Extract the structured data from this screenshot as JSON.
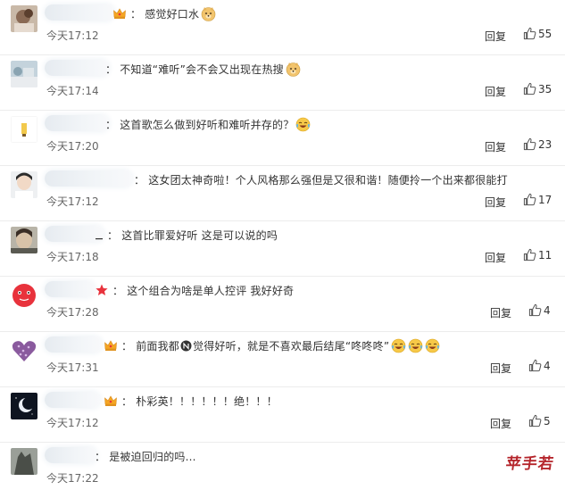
{
  "comments": [
    {
      "text": "感觉好口水",
      "time": "今天17:12",
      "reply": "回复",
      "likes": "55",
      "badge": "crown",
      "emoji": [
        "doge"
      ]
    },
    {
      "text": "不知道“难听”会不会又出现在热搜",
      "time": "今天17:14",
      "reply": "回复",
      "likes": "35",
      "badge": "none",
      "emoji": [
        "doge"
      ]
    },
    {
      "text": "这首歌怎么做到好听和难听并存的？",
      "time": "今天17:20",
      "reply": "回复",
      "likes": "23",
      "badge": "none",
      "emoji": [
        "laugh-cry"
      ]
    },
    {
      "text": "这女团太神奇啦！个人风格那么强但是又很和谐！随便拎一个出来都很能打",
      "time": "今天17:12",
      "reply": "回复",
      "likes": "17",
      "badge": "none",
      "emoji": []
    },
    {
      "text": "这首比罪爱好听 这是可以说的吗",
      "time": "今天17:18",
      "reply": "回复",
      "likes": "11",
      "badge": "underscore",
      "emoji": []
    },
    {
      "text": "这个组合为啥是单人控评 我好好奇",
      "time": "今天17:28",
      "reply": "回复",
      "likes": "4",
      "badge": "star",
      "emoji": []
    },
    {
      "text_a": "前面我都",
      "text_b": "觉得好听，就是不喜欢最后结尾“咚咚咚”",
      "time": "今天17:31",
      "reply": "回复",
      "likes": "4",
      "badge": "crown",
      "emoji": [
        "laugh-cry",
        "laugh-cry",
        "laugh-cry"
      ]
    },
    {
      "text": "朴彩英！！！！！！绝！！！",
      "time": "今天17:12",
      "reply": "回复",
      "likes": "5",
      "badge": "crown",
      "emoji": []
    },
    {
      "text": "是被迫回归的吗...",
      "time": "今天17:22",
      "reply": "回复",
      "likes": "",
      "badge": "none",
      "emoji": []
    }
  ],
  "separator": "：",
  "watermark": "苹手若",
  "colors": {
    "crown": "#f5a623",
    "star": "#e8323c",
    "emoji_face": "#f7c948",
    "text": "#333333",
    "meta": "#666666",
    "watermark": "#b5262c"
  },
  "icons": {
    "like": "thumbs-up-icon",
    "badge_crown": "crown-icon",
    "badge_star": "star-icon",
    "emoji_doge": "doge-emoji-icon",
    "emoji_laugh": "laugh-cry-emoji-icon",
    "inline": "circle-n-icon"
  }
}
